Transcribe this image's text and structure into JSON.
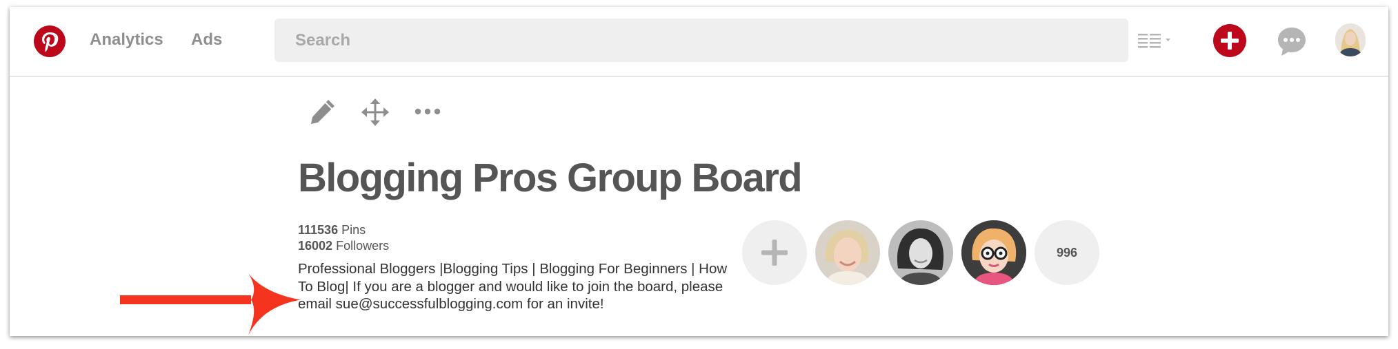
{
  "header": {
    "nav": [
      {
        "label": "Analytics"
      },
      {
        "label": "Ads"
      }
    ],
    "search": {
      "placeholder": "Search"
    }
  },
  "board": {
    "title": "Blogging Pros Group Board",
    "stats": [
      {
        "value": "111536",
        "label": "Pins"
      },
      {
        "value": "16002",
        "label": "Followers"
      }
    ],
    "description": "Professional Bloggers |Blogging Tips | Blogging For Beginners | How To Blog| If you are a blogger and would like to join the board, please email sue@successfulblogging.com for an invite!",
    "collaborator_count": "996"
  },
  "colors": {
    "brand_red": "#bd081c",
    "annotation_arrow": "#f5341f",
    "icon_gray": "#8e8e8e"
  },
  "icons": [
    "pinterest-logo-icon",
    "view-options-icon",
    "add-pin-icon",
    "messages-icon",
    "profile-avatar",
    "edit-pencil-icon",
    "move-arrows-icon",
    "more-dots-icon",
    "add-collaborator-icon"
  ]
}
